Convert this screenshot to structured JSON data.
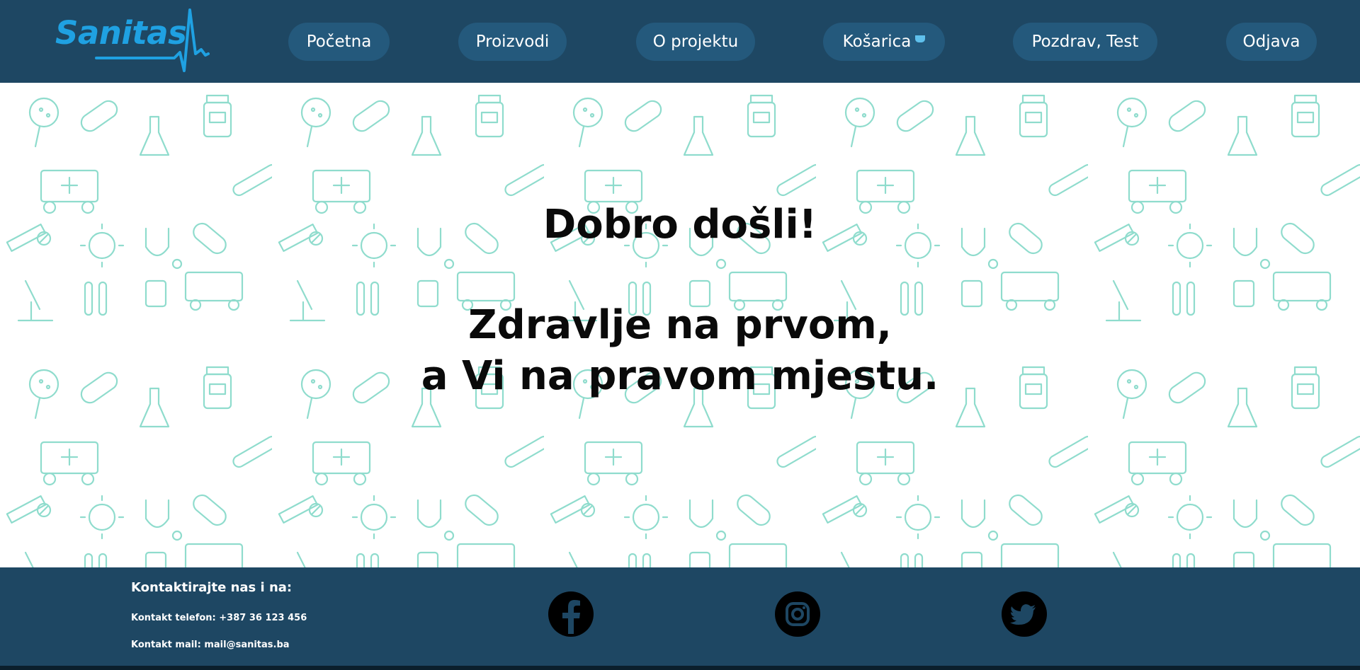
{
  "header": {
    "logo_text": "Sanitas",
    "nav": [
      {
        "label": "Početna"
      },
      {
        "label": "Proizvodi"
      },
      {
        "label": "O projektu"
      },
      {
        "label": "Košarica"
      },
      {
        "label": "Pozdrav, Test"
      },
      {
        "label": "Odjava"
      }
    ]
  },
  "hero": {
    "welcome": "Dobro došli!",
    "tagline_line1": "Zdravlje na prvom,",
    "tagline_line2": "a Vi na pravom mjestu."
  },
  "footer": {
    "contact_title": "Kontaktirajte nas i na:",
    "phone": "Kontakt telefon: +387 36 123 456",
    "mail": "Kontakt mail: mail@sanitas.ba",
    "social": [
      "facebook-icon",
      "instagram-icon",
      "twitter-icon"
    ]
  },
  "colors": {
    "header_bg": "#1e4763",
    "nav_pill": "#24597c",
    "logo": "#1fa1e2",
    "pattern": "#8fdccd"
  }
}
